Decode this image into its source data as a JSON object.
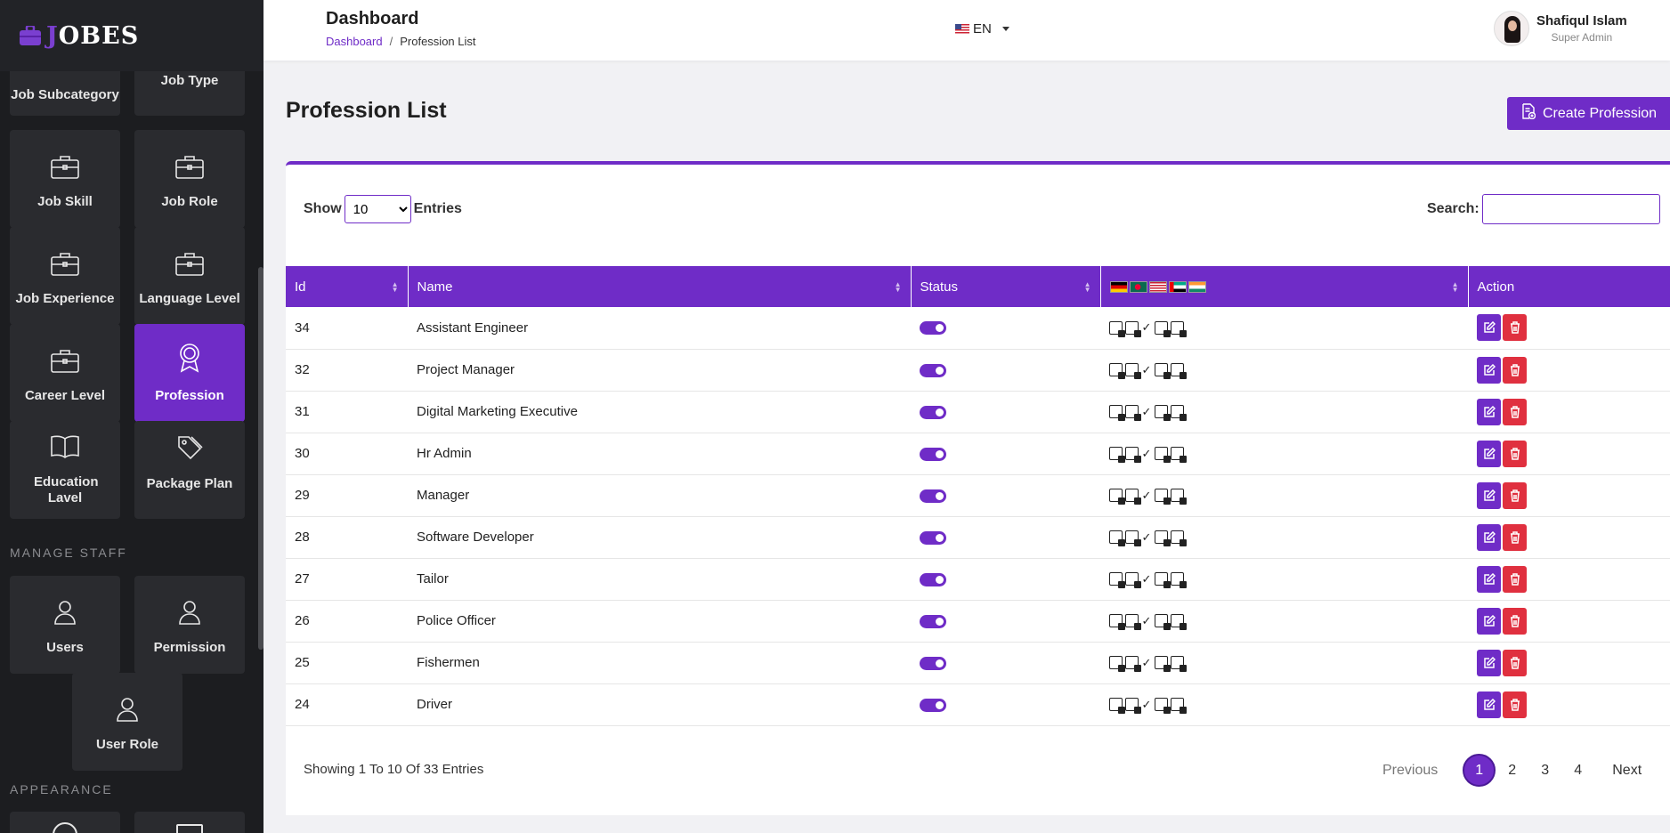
{
  "brand": {
    "prefix": "J",
    "rest": "OBES"
  },
  "sidebar": {
    "tiles": [
      {
        "label": "Job Subcategory",
        "icon": "briefcase-icon"
      },
      {
        "label": "Job Type",
        "icon": "briefcase-icon"
      },
      {
        "label": "Job Skill",
        "icon": "briefcase-icon"
      },
      {
        "label": "Job Role",
        "icon": "briefcase-icon"
      },
      {
        "label": "Job Experience",
        "icon": "briefcase-icon"
      },
      {
        "label": "Language Level",
        "icon": "briefcase-icon"
      },
      {
        "label": "Career Level",
        "icon": "briefcase-icon"
      },
      {
        "label": "Profession",
        "icon": "award-icon",
        "active": true
      },
      {
        "label": "Education Lavel",
        "icon": "book-icon"
      },
      {
        "label": "Package Plan",
        "icon": "tag-icon"
      }
    ],
    "manage_staff_label": "MANAGE STAFF",
    "staff_tiles": [
      {
        "label": "Users",
        "icon": "user-icon"
      },
      {
        "label": "Permission",
        "icon": "user-icon"
      },
      {
        "label": "User Role",
        "icon": "user-icon"
      }
    ],
    "appearance_label": "APPEARANCE"
  },
  "header": {
    "title": "Dashboard",
    "breadcrumb": {
      "home": "Dashboard",
      "separator": "/",
      "current": "Profession List"
    },
    "language": "EN",
    "user": {
      "name": "Shafiqul Islam",
      "role": "Super Admin"
    }
  },
  "main": {
    "title": "Profession List",
    "create_button": "Create Profession",
    "show_label": "Show",
    "entries_label": "Entries",
    "page_size": "10",
    "page_size_options": [
      "10"
    ],
    "search_label": "Search:",
    "search_value": "",
    "columns": [
      "Id",
      "Name",
      "Status",
      "",
      "Action"
    ],
    "flags": [
      "de",
      "bd",
      "us",
      "ae",
      "in"
    ],
    "rows": [
      {
        "id": "34",
        "name": "Assistant Engineer"
      },
      {
        "id": "32",
        "name": "Project Manager"
      },
      {
        "id": "31",
        "name": "Digital Marketing Executive"
      },
      {
        "id": "30",
        "name": "Hr Admin"
      },
      {
        "id": "29",
        "name": "Manager"
      },
      {
        "id": "28",
        "name": "Software Developer"
      },
      {
        "id": "27",
        "name": "Tailor"
      },
      {
        "id": "26",
        "name": "Police Officer"
      },
      {
        "id": "25",
        "name": "Fishermen"
      },
      {
        "id": "24",
        "name": "Driver"
      }
    ],
    "info": "Showing 1 To 10 Of 33 Entries",
    "pagination": {
      "previous": "Previous",
      "pages": [
        "1",
        "2",
        "3",
        "4"
      ],
      "current": "1",
      "next": "Next"
    }
  },
  "colors": {
    "accent": "#6f2cc7",
    "danger": "#e0303f",
    "sidebar": "#1c1d20"
  }
}
